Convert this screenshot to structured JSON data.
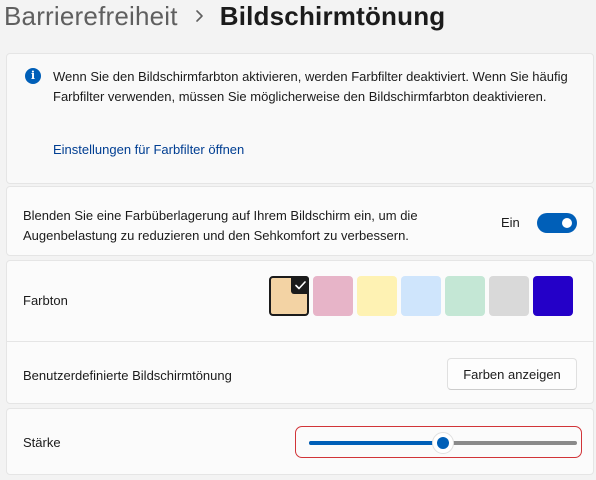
{
  "breadcrumb": {
    "parent": "Barrierefreiheit",
    "current": "Bildschirmtönung"
  },
  "info": {
    "icon": "info-icon",
    "text": "Wenn Sie den Bildschirmfarbton aktivieren, werden Farbfilter deaktiviert. Wenn Sie häufig Farbfilter verwenden, müssen Sie möglicherweise den Bildschirmfarbton deaktivieren.",
    "link": "Einstellungen für Farbfilter öffnen"
  },
  "overlay": {
    "description": "Blenden Sie eine Farbüberlagerung auf Ihrem Bildschirm ein, um die Augenbelastung zu reduzieren und den Sehkomfort zu verbessern.",
    "state": "Ein",
    "enabled": true
  },
  "tint": {
    "label": "Farbton",
    "swatches": [
      "#f3d3a4",
      "#e7b4c8",
      "#fef2b3",
      "#cfe5fc",
      "#c4e7d5",
      "#d9d9d9",
      "#2400c8"
    ],
    "selected_index": 0
  },
  "custom": {
    "label": "Benutzerdefinierte Bildschirmtönung",
    "button": "Farben anzeigen"
  },
  "strength": {
    "label": "Stärke",
    "value": 0.5
  },
  "colors": {
    "accent": "#005fb8",
    "highlight": "#d13438"
  }
}
